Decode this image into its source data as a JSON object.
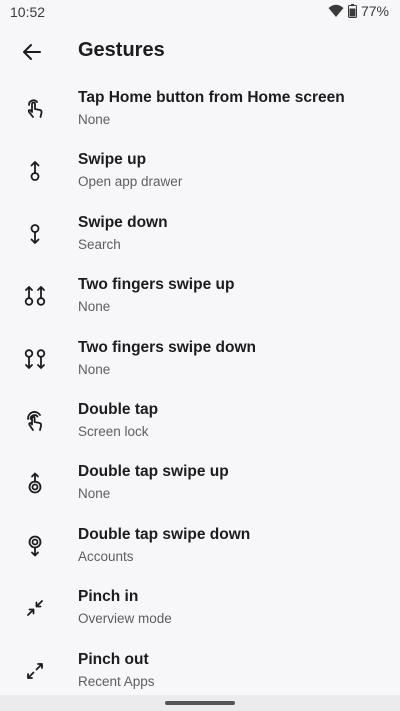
{
  "status": {
    "time": "10:52",
    "battery": "77%",
    "icons": [
      "wifi-icon",
      "battery-icon"
    ]
  },
  "header": {
    "title": "Gestures",
    "back_icon": "back-arrow-icon"
  },
  "items": [
    {
      "title": "Tap Home button from Home screen",
      "summary": "None",
      "icon": "tap-gesture-icon"
    },
    {
      "title": "Swipe up",
      "summary": "Open app drawer",
      "icon": "swipe-up-icon"
    },
    {
      "title": "Swipe down",
      "summary": "Search",
      "icon": "swipe-down-icon"
    },
    {
      "title": "Two fingers swipe up",
      "summary": "None",
      "icon": "two-finger-swipe-up-icon"
    },
    {
      "title": "Two fingers swipe down",
      "summary": "None",
      "icon": "two-finger-swipe-down-icon"
    },
    {
      "title": "Double tap",
      "summary": "Screen lock",
      "icon": "double-tap-icon"
    },
    {
      "title": "Double tap swipe up",
      "summary": "None",
      "icon": "double-tap-swipe-up-icon"
    },
    {
      "title": "Double tap swipe down",
      "summary": "Accounts",
      "icon": "double-tap-swipe-down-icon"
    },
    {
      "title": "Pinch in",
      "summary": "Overview mode",
      "icon": "pinch-in-icon"
    },
    {
      "title": "Pinch out",
      "summary": "Recent Apps",
      "icon": "pinch-out-icon"
    }
  ],
  "colors": {
    "background": "#f7f6f8",
    "text": "#1c1b1f",
    "secondary_text": "#5f5d63"
  }
}
